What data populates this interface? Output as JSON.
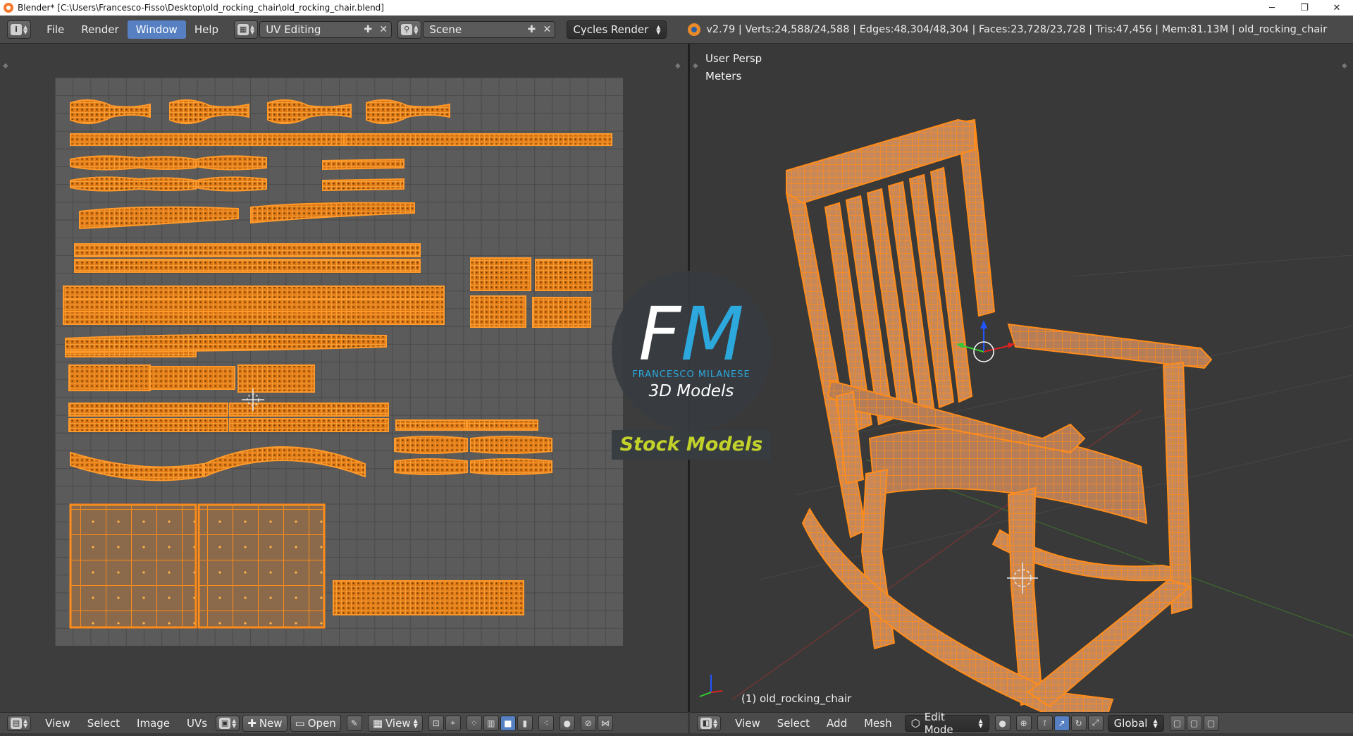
{
  "window": {
    "title": "Blender* [C:\\Users\\Francesco-Fisso\\Desktop\\old_rocking_chair\\old_rocking_chair.blend]",
    "minimize": "─",
    "restore": "❐",
    "close": "✕"
  },
  "topbar": {
    "menu": [
      "File",
      "Render",
      "Window",
      "Help"
    ],
    "active_menu": "Window",
    "screen_layout": "UV Editing",
    "scene": "Scene",
    "render_engine": "Cycles Render",
    "stats": "v2.79 | Verts:24,588/24,588 | Edges:48,304/48,304 | Faces:23,728/23,728 | Tris:47,456 | Mem:81.13M | old_rocking_chair"
  },
  "viewport": {
    "view_name": "User Persp",
    "units": "Meters",
    "object_label": "(1) old_rocking_chair"
  },
  "uv_bottom": {
    "menus": [
      "View",
      "Select",
      "Image",
      "UVs"
    ],
    "new_label": "New",
    "open_label": "Open",
    "view_label": "View"
  },
  "vp_bottom": {
    "menus": [
      "View",
      "Select",
      "Add",
      "Mesh"
    ],
    "mode": "Edit Mode",
    "orientation": "Global"
  },
  "watermark": {
    "initial_f": "F",
    "initial_m": "M",
    "name": "FRANCESCO MILANESE",
    "subtitle": "3D Models",
    "banner": "Stock Models"
  },
  "colors": {
    "selection_orange": "#ff8c1a",
    "face_fill": "#8a6a4a",
    "accent_blue": "#5680c2",
    "watermark_blue": "#2ca8dd",
    "watermark_green": "#c3d22a"
  }
}
